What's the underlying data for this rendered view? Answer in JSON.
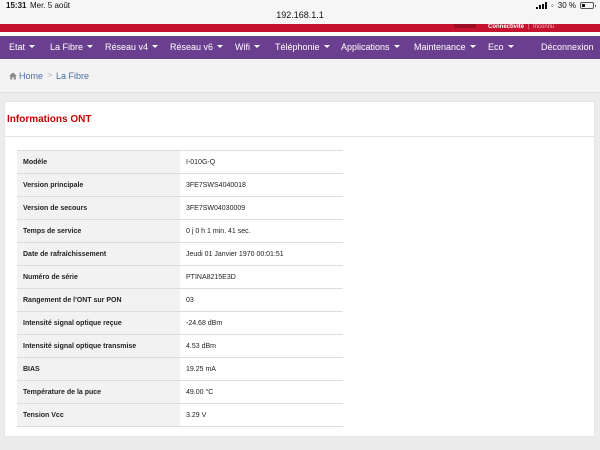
{
  "statusbar": {
    "time": "15:31",
    "date": "Mer. 5 août",
    "battery": "30 %",
    "battery_level": 0.3
  },
  "browser": {
    "url": "192.168.1.1"
  },
  "brand": {
    "connectivity_label": "Connectivité",
    "connectivity_sep": "|",
    "connectivity_value": "Inconnu",
    "accent_color": "#c4122f"
  },
  "nav": {
    "color": "#6b3f8f",
    "items": [
      {
        "label": "Etat"
      },
      {
        "label": "La Fibre"
      },
      {
        "label": "Réseau v4"
      },
      {
        "label": "Réseau v6"
      },
      {
        "label": "Wifi"
      },
      {
        "label": "Téléphonie"
      },
      {
        "label": "Applications"
      },
      {
        "label": "Maintenance"
      },
      {
        "label": "Eco"
      }
    ],
    "logout": "Déconnexion"
  },
  "breadcrumb": {
    "home": "Home",
    "separator": ">",
    "current": "La Fibre",
    "home_icon": "home-icon"
  },
  "section": {
    "title": "Informations ONT"
  },
  "table": {
    "rows": [
      {
        "key": "Modèle",
        "value": "I-010G-Q"
      },
      {
        "key": "Version principale",
        "value": "3FE7SWS4040018"
      },
      {
        "key": "Version de secours",
        "value": "3FE7SW04030009"
      },
      {
        "key": "Temps de service",
        "value": "0 j 0 h 1 min. 41 sec."
      },
      {
        "key": "Date de rafraîchissement",
        "value": "Jeudi 01 Janvier 1970 00:01:51"
      },
      {
        "key": "Numéro de série",
        "value": "PTINA8215E3D"
      },
      {
        "key": "Rangement de l'ONT sur PON",
        "value": "03"
      },
      {
        "key": "Intensité signal optique reçue",
        "value": "-24.68 dBm"
      },
      {
        "key": "Intensité signal optique transmise",
        "value": "4.53 dBm"
      },
      {
        "key": "BIAS",
        "value": "19.25 mA"
      },
      {
        "key": "Température de la puce",
        "value": "49.00 °C"
      },
      {
        "key": "Tension Vcc",
        "value": "3.29 V"
      }
    ]
  }
}
